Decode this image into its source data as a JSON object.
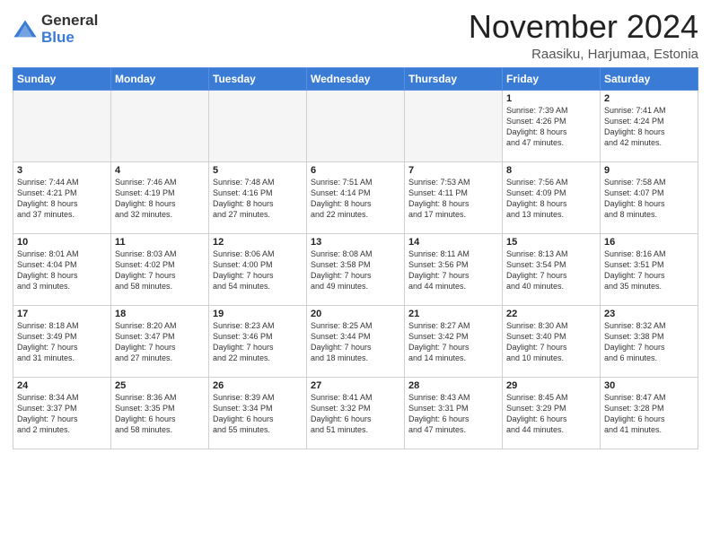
{
  "logo": {
    "general": "General",
    "blue": "Blue"
  },
  "title": "November 2024",
  "location": "Raasiku, Harjumaa, Estonia",
  "weekdays": [
    "Sunday",
    "Monday",
    "Tuesday",
    "Wednesday",
    "Thursday",
    "Friday",
    "Saturday"
  ],
  "weeks": [
    [
      {
        "day": "",
        "info": ""
      },
      {
        "day": "",
        "info": ""
      },
      {
        "day": "",
        "info": ""
      },
      {
        "day": "",
        "info": ""
      },
      {
        "day": "",
        "info": ""
      },
      {
        "day": "1",
        "info": "Sunrise: 7:39 AM\nSunset: 4:26 PM\nDaylight: 8 hours\nand 47 minutes."
      },
      {
        "day": "2",
        "info": "Sunrise: 7:41 AM\nSunset: 4:24 PM\nDaylight: 8 hours\nand 42 minutes."
      }
    ],
    [
      {
        "day": "3",
        "info": "Sunrise: 7:44 AM\nSunset: 4:21 PM\nDaylight: 8 hours\nand 37 minutes."
      },
      {
        "day": "4",
        "info": "Sunrise: 7:46 AM\nSunset: 4:19 PM\nDaylight: 8 hours\nand 32 minutes."
      },
      {
        "day": "5",
        "info": "Sunrise: 7:48 AM\nSunset: 4:16 PM\nDaylight: 8 hours\nand 27 minutes."
      },
      {
        "day": "6",
        "info": "Sunrise: 7:51 AM\nSunset: 4:14 PM\nDaylight: 8 hours\nand 22 minutes."
      },
      {
        "day": "7",
        "info": "Sunrise: 7:53 AM\nSunset: 4:11 PM\nDaylight: 8 hours\nand 17 minutes."
      },
      {
        "day": "8",
        "info": "Sunrise: 7:56 AM\nSunset: 4:09 PM\nDaylight: 8 hours\nand 13 minutes."
      },
      {
        "day": "9",
        "info": "Sunrise: 7:58 AM\nSunset: 4:07 PM\nDaylight: 8 hours\nand 8 minutes."
      }
    ],
    [
      {
        "day": "10",
        "info": "Sunrise: 8:01 AM\nSunset: 4:04 PM\nDaylight: 8 hours\nand 3 minutes."
      },
      {
        "day": "11",
        "info": "Sunrise: 8:03 AM\nSunset: 4:02 PM\nDaylight: 7 hours\nand 58 minutes."
      },
      {
        "day": "12",
        "info": "Sunrise: 8:06 AM\nSunset: 4:00 PM\nDaylight: 7 hours\nand 54 minutes."
      },
      {
        "day": "13",
        "info": "Sunrise: 8:08 AM\nSunset: 3:58 PM\nDaylight: 7 hours\nand 49 minutes."
      },
      {
        "day": "14",
        "info": "Sunrise: 8:11 AM\nSunset: 3:56 PM\nDaylight: 7 hours\nand 44 minutes."
      },
      {
        "day": "15",
        "info": "Sunrise: 8:13 AM\nSunset: 3:54 PM\nDaylight: 7 hours\nand 40 minutes."
      },
      {
        "day": "16",
        "info": "Sunrise: 8:16 AM\nSunset: 3:51 PM\nDaylight: 7 hours\nand 35 minutes."
      }
    ],
    [
      {
        "day": "17",
        "info": "Sunrise: 8:18 AM\nSunset: 3:49 PM\nDaylight: 7 hours\nand 31 minutes."
      },
      {
        "day": "18",
        "info": "Sunrise: 8:20 AM\nSunset: 3:47 PM\nDaylight: 7 hours\nand 27 minutes."
      },
      {
        "day": "19",
        "info": "Sunrise: 8:23 AM\nSunset: 3:46 PM\nDaylight: 7 hours\nand 22 minutes."
      },
      {
        "day": "20",
        "info": "Sunrise: 8:25 AM\nSunset: 3:44 PM\nDaylight: 7 hours\nand 18 minutes."
      },
      {
        "day": "21",
        "info": "Sunrise: 8:27 AM\nSunset: 3:42 PM\nDaylight: 7 hours\nand 14 minutes."
      },
      {
        "day": "22",
        "info": "Sunrise: 8:30 AM\nSunset: 3:40 PM\nDaylight: 7 hours\nand 10 minutes."
      },
      {
        "day": "23",
        "info": "Sunrise: 8:32 AM\nSunset: 3:38 PM\nDaylight: 7 hours\nand 6 minutes."
      }
    ],
    [
      {
        "day": "24",
        "info": "Sunrise: 8:34 AM\nSunset: 3:37 PM\nDaylight: 7 hours\nand 2 minutes."
      },
      {
        "day": "25",
        "info": "Sunrise: 8:36 AM\nSunset: 3:35 PM\nDaylight: 6 hours\nand 58 minutes."
      },
      {
        "day": "26",
        "info": "Sunrise: 8:39 AM\nSunset: 3:34 PM\nDaylight: 6 hours\nand 55 minutes."
      },
      {
        "day": "27",
        "info": "Sunrise: 8:41 AM\nSunset: 3:32 PM\nDaylight: 6 hours\nand 51 minutes."
      },
      {
        "day": "28",
        "info": "Sunrise: 8:43 AM\nSunset: 3:31 PM\nDaylight: 6 hours\nand 47 minutes."
      },
      {
        "day": "29",
        "info": "Sunrise: 8:45 AM\nSunset: 3:29 PM\nDaylight: 6 hours\nand 44 minutes."
      },
      {
        "day": "30",
        "info": "Sunrise: 8:47 AM\nSunset: 3:28 PM\nDaylight: 6 hours\nand 41 minutes."
      }
    ]
  ]
}
